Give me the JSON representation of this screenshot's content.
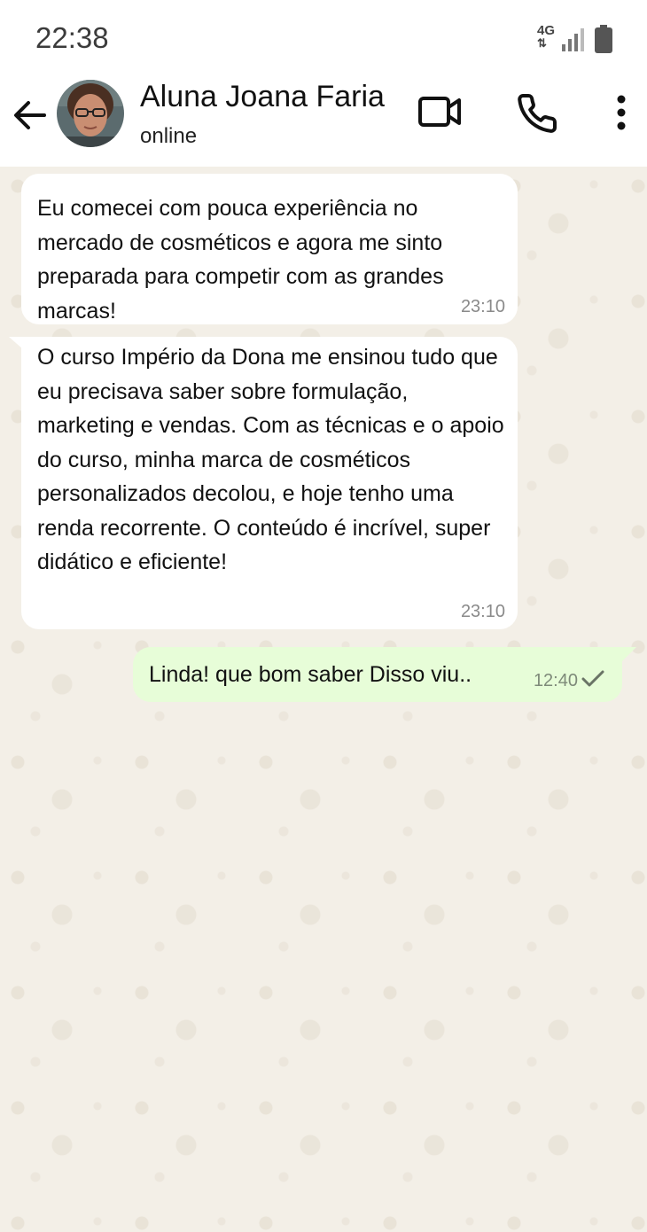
{
  "status_bar": {
    "time": "22:38",
    "network": "4G"
  },
  "header": {
    "contact_name": "Aluna Joana Faria",
    "contact_status": "online"
  },
  "messages": [
    {
      "direction": "incoming",
      "text": "Eu comecei com pouca experiência no mercado de cosméticos e agora me sinto preparada para competir com as grandes marcas!",
      "time": "23:10"
    },
    {
      "direction": "incoming",
      "text": "O curso Império da Dona me ensinou tudo que eu precisava saber sobre formulação, marketing e vendas. Com as técnicas e o apoio do curso, minha marca de cosméticos personalizados decolou, e hoje tenho uma renda recorrente. O conteúdo é incrível, super didático e eficiente!",
      "time": "23:10"
    },
    {
      "direction": "outgoing",
      "text": "Linda! que bom saber Disso viu..",
      "time": "12:40",
      "status": "sent"
    }
  ],
  "colors": {
    "chat_background": "#f3efe7",
    "incoming_bubble": "#ffffff",
    "outgoing_bubble": "#e7fdd8"
  },
  "icons": [
    "back-arrow-icon",
    "video-call-icon",
    "phone-icon",
    "more-options-icon",
    "signal-icon",
    "battery-icon",
    "checkmark-icon"
  ]
}
